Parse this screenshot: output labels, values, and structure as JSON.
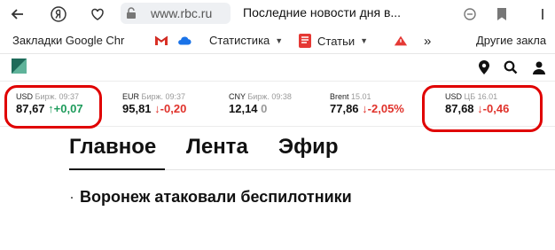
{
  "browser": {
    "url": "www.rbc.ru",
    "tab_title": "Последние новости дня в..."
  },
  "bookmarks": {
    "items": [
      {
        "label": "Закладки Google Chr",
        "icon": "bookmark-folder-icon"
      },
      {
        "label": "",
        "icon": "gmail-icon"
      },
      {
        "label": "",
        "icon": "cloud-icon"
      },
      {
        "label": "Статистика",
        "icon": ""
      },
      {
        "label": "Статьи",
        "icon": "doc-icon"
      },
      {
        "label": "",
        "icon": "warning-icon"
      }
    ],
    "more": "»",
    "other": "Другие закла"
  },
  "ticker": [
    {
      "symbol": "USD",
      "source": "Бирж. 09:37",
      "value": "87,67",
      "arrow": "↑",
      "change": "+0,07",
      "direction": "up"
    },
    {
      "symbol": "EUR",
      "source": "Бирж. 09:37",
      "value": "95,81",
      "arrow": "↓",
      "change": "-0,20",
      "direction": "down"
    },
    {
      "symbol": "CNY",
      "source": "Бирж. 09:38",
      "value": "12,14",
      "arrow": "",
      "change": "0",
      "direction": "zero"
    },
    {
      "symbol": "Brent",
      "source": "15.01",
      "value": "77,86",
      "arrow": "↓",
      "change": "-2,05%",
      "direction": "down"
    },
    {
      "symbol": "USD",
      "source": "ЦБ 16.01",
      "value": "87,68",
      "arrow": "↓",
      "change": "-0,46",
      "direction": "down"
    }
  ],
  "main_tabs": [
    "Главное",
    "Лента",
    "Эфир"
  ],
  "headline": {
    "bullet": "·",
    "text": "Воронеж атаковали беспилотники"
  },
  "colors": {
    "up": "#1d9b5b",
    "down": "#e0322b",
    "highlight": "#e00000",
    "logo": "#1f6b5a"
  }
}
